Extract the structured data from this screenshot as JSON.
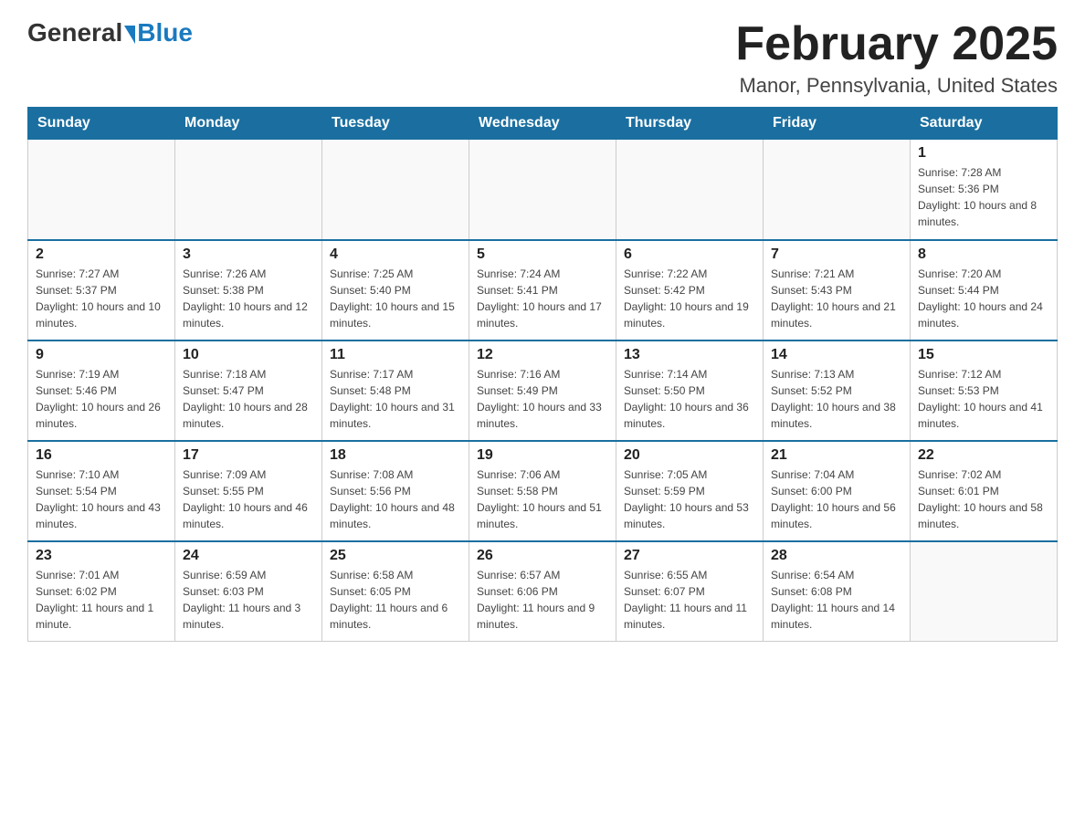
{
  "logo": {
    "general": "General",
    "blue": "Blue"
  },
  "title": "February 2025",
  "subtitle": "Manor, Pennsylvania, United States",
  "weekdays": [
    "Sunday",
    "Monday",
    "Tuesday",
    "Wednesday",
    "Thursday",
    "Friday",
    "Saturday"
  ],
  "weeks": [
    [
      {
        "day": "",
        "info": ""
      },
      {
        "day": "",
        "info": ""
      },
      {
        "day": "",
        "info": ""
      },
      {
        "day": "",
        "info": ""
      },
      {
        "day": "",
        "info": ""
      },
      {
        "day": "",
        "info": ""
      },
      {
        "day": "1",
        "info": "Sunrise: 7:28 AM\nSunset: 5:36 PM\nDaylight: 10 hours and 8 minutes."
      }
    ],
    [
      {
        "day": "2",
        "info": "Sunrise: 7:27 AM\nSunset: 5:37 PM\nDaylight: 10 hours and 10 minutes."
      },
      {
        "day": "3",
        "info": "Sunrise: 7:26 AM\nSunset: 5:38 PM\nDaylight: 10 hours and 12 minutes."
      },
      {
        "day": "4",
        "info": "Sunrise: 7:25 AM\nSunset: 5:40 PM\nDaylight: 10 hours and 15 minutes."
      },
      {
        "day": "5",
        "info": "Sunrise: 7:24 AM\nSunset: 5:41 PM\nDaylight: 10 hours and 17 minutes."
      },
      {
        "day": "6",
        "info": "Sunrise: 7:22 AM\nSunset: 5:42 PM\nDaylight: 10 hours and 19 minutes."
      },
      {
        "day": "7",
        "info": "Sunrise: 7:21 AM\nSunset: 5:43 PM\nDaylight: 10 hours and 21 minutes."
      },
      {
        "day": "8",
        "info": "Sunrise: 7:20 AM\nSunset: 5:44 PM\nDaylight: 10 hours and 24 minutes."
      }
    ],
    [
      {
        "day": "9",
        "info": "Sunrise: 7:19 AM\nSunset: 5:46 PM\nDaylight: 10 hours and 26 minutes."
      },
      {
        "day": "10",
        "info": "Sunrise: 7:18 AM\nSunset: 5:47 PM\nDaylight: 10 hours and 28 minutes."
      },
      {
        "day": "11",
        "info": "Sunrise: 7:17 AM\nSunset: 5:48 PM\nDaylight: 10 hours and 31 minutes."
      },
      {
        "day": "12",
        "info": "Sunrise: 7:16 AM\nSunset: 5:49 PM\nDaylight: 10 hours and 33 minutes."
      },
      {
        "day": "13",
        "info": "Sunrise: 7:14 AM\nSunset: 5:50 PM\nDaylight: 10 hours and 36 minutes."
      },
      {
        "day": "14",
        "info": "Sunrise: 7:13 AM\nSunset: 5:52 PM\nDaylight: 10 hours and 38 minutes."
      },
      {
        "day": "15",
        "info": "Sunrise: 7:12 AM\nSunset: 5:53 PM\nDaylight: 10 hours and 41 minutes."
      }
    ],
    [
      {
        "day": "16",
        "info": "Sunrise: 7:10 AM\nSunset: 5:54 PM\nDaylight: 10 hours and 43 minutes."
      },
      {
        "day": "17",
        "info": "Sunrise: 7:09 AM\nSunset: 5:55 PM\nDaylight: 10 hours and 46 minutes."
      },
      {
        "day": "18",
        "info": "Sunrise: 7:08 AM\nSunset: 5:56 PM\nDaylight: 10 hours and 48 minutes."
      },
      {
        "day": "19",
        "info": "Sunrise: 7:06 AM\nSunset: 5:58 PM\nDaylight: 10 hours and 51 minutes."
      },
      {
        "day": "20",
        "info": "Sunrise: 7:05 AM\nSunset: 5:59 PM\nDaylight: 10 hours and 53 minutes."
      },
      {
        "day": "21",
        "info": "Sunrise: 7:04 AM\nSunset: 6:00 PM\nDaylight: 10 hours and 56 minutes."
      },
      {
        "day": "22",
        "info": "Sunrise: 7:02 AM\nSunset: 6:01 PM\nDaylight: 10 hours and 58 minutes."
      }
    ],
    [
      {
        "day": "23",
        "info": "Sunrise: 7:01 AM\nSunset: 6:02 PM\nDaylight: 11 hours and 1 minute."
      },
      {
        "day": "24",
        "info": "Sunrise: 6:59 AM\nSunset: 6:03 PM\nDaylight: 11 hours and 3 minutes."
      },
      {
        "day": "25",
        "info": "Sunrise: 6:58 AM\nSunset: 6:05 PM\nDaylight: 11 hours and 6 minutes."
      },
      {
        "day": "26",
        "info": "Sunrise: 6:57 AM\nSunset: 6:06 PM\nDaylight: 11 hours and 9 minutes."
      },
      {
        "day": "27",
        "info": "Sunrise: 6:55 AM\nSunset: 6:07 PM\nDaylight: 11 hours and 11 minutes."
      },
      {
        "day": "28",
        "info": "Sunrise: 6:54 AM\nSunset: 6:08 PM\nDaylight: 11 hours and 14 minutes."
      },
      {
        "day": "",
        "info": ""
      }
    ]
  ]
}
